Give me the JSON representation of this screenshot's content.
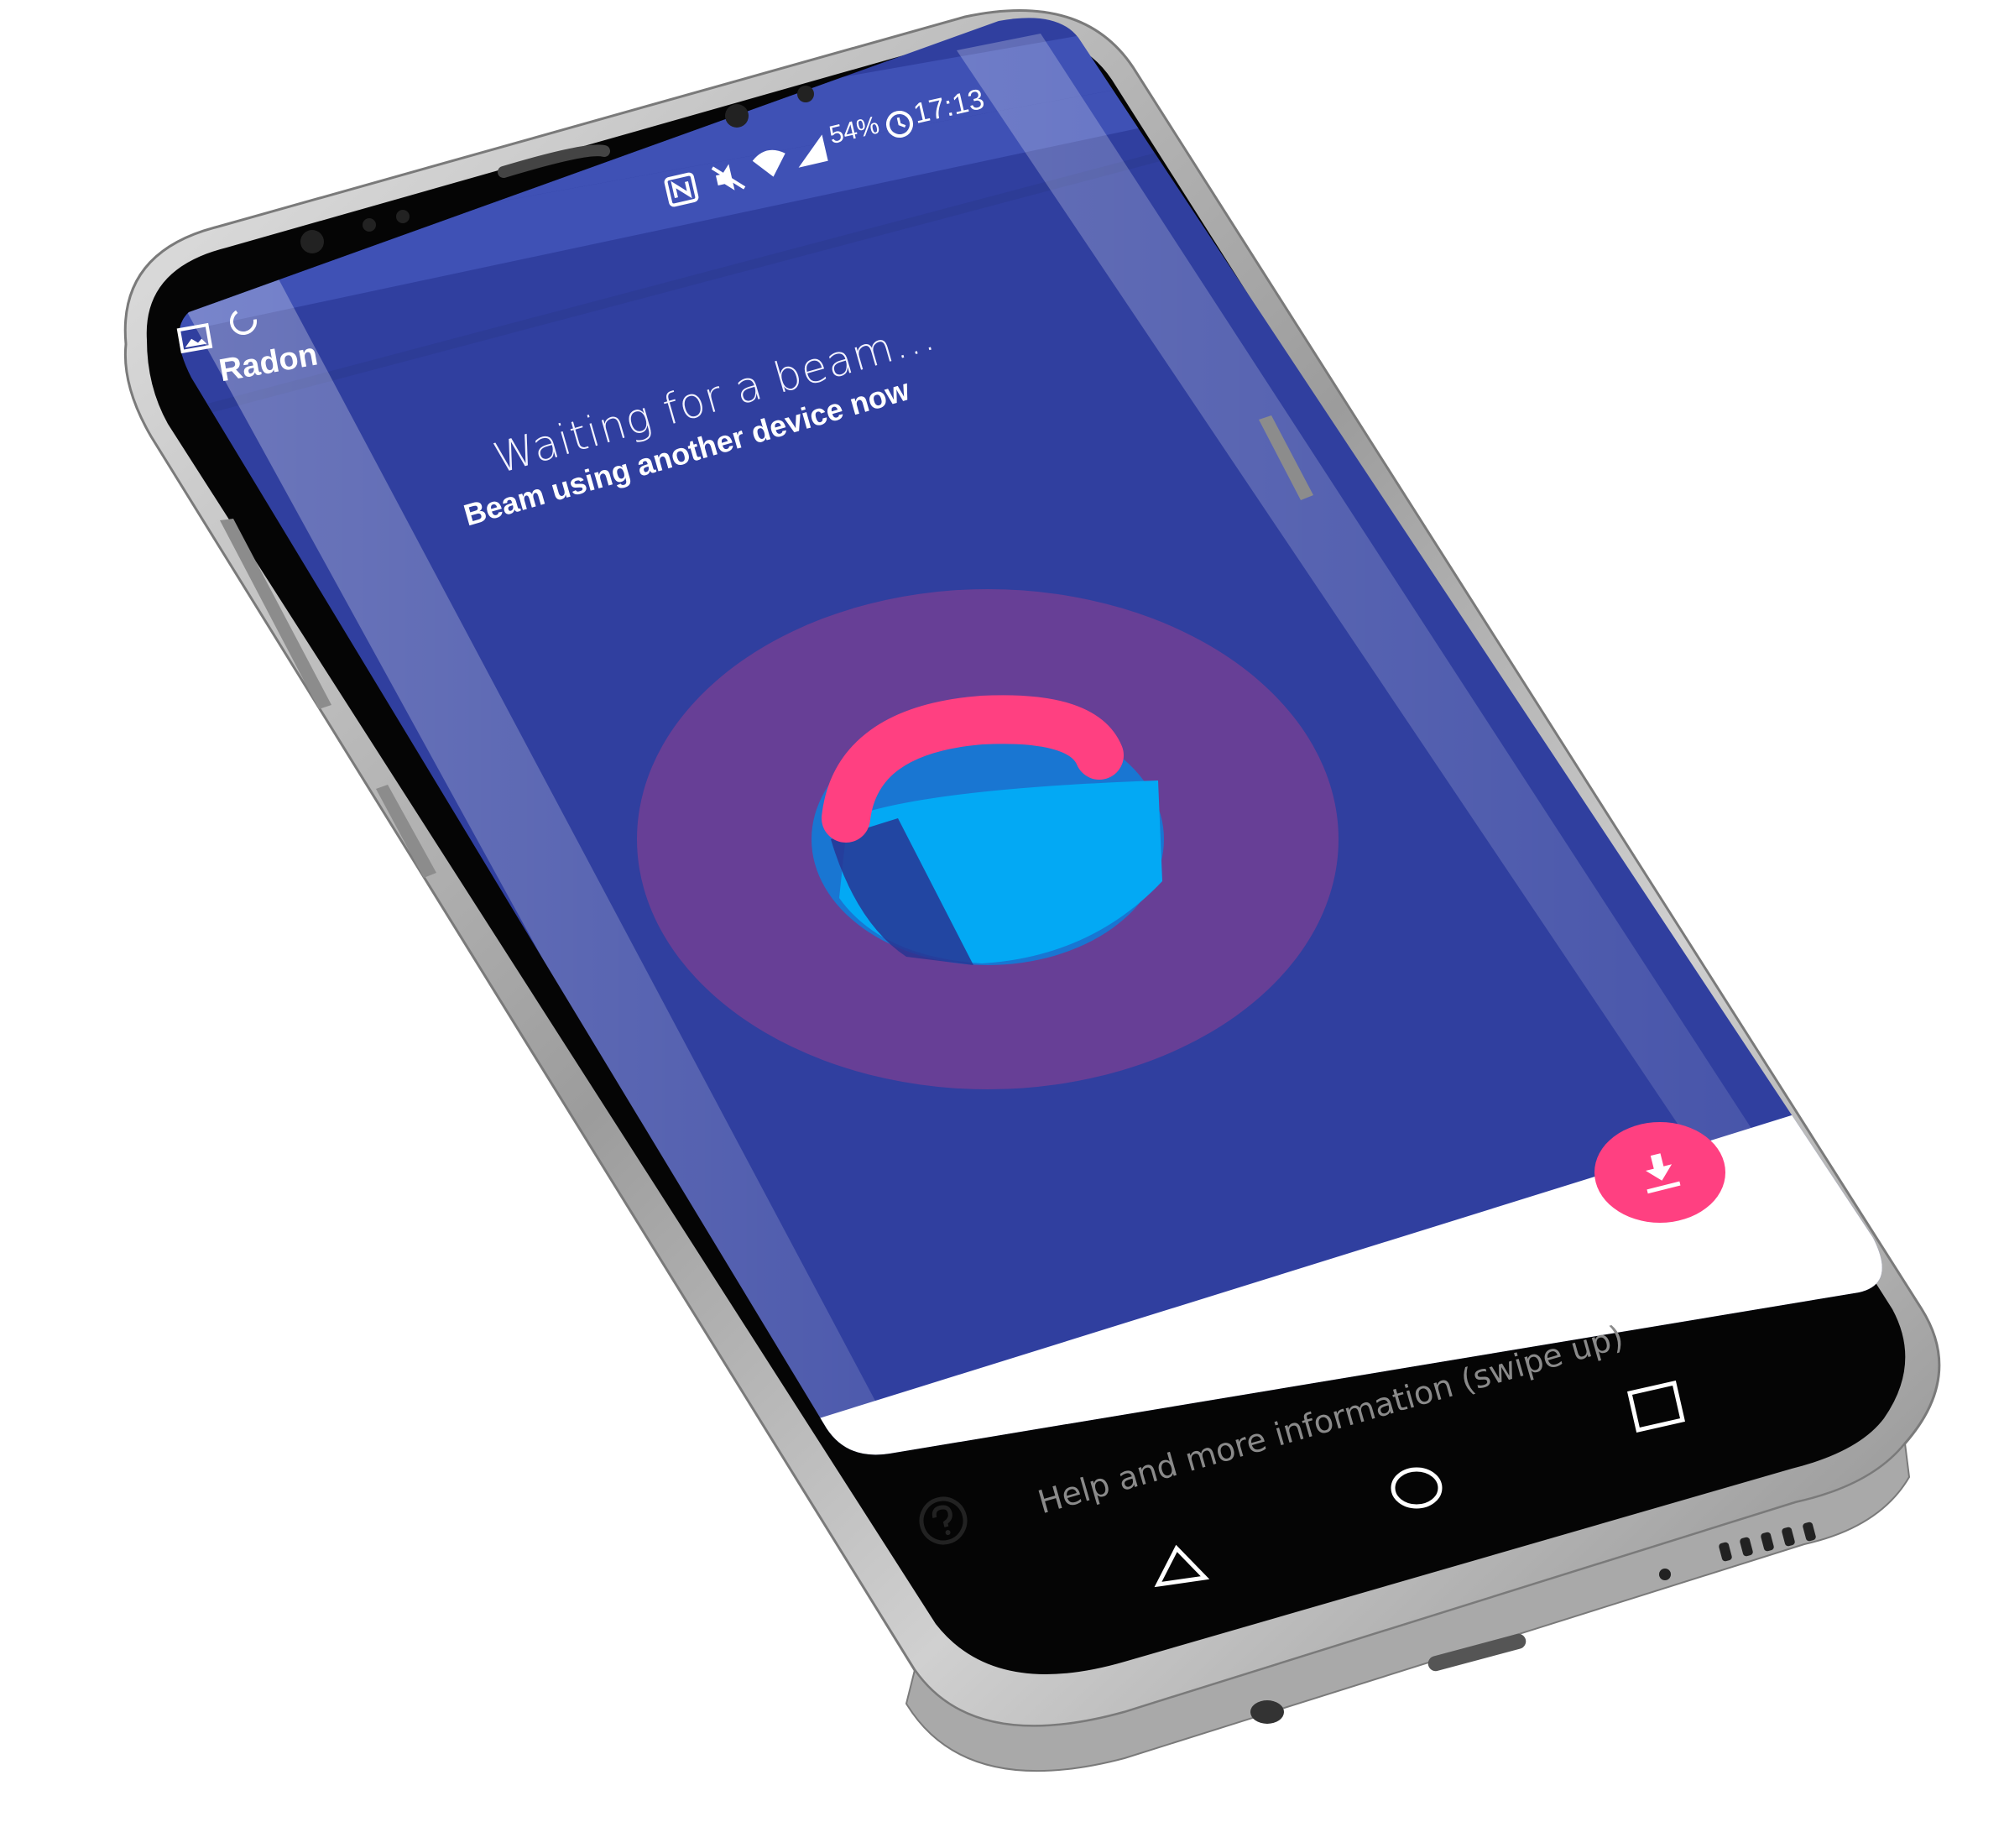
{
  "status_bar": {
    "time": "17:13",
    "battery": "54%",
    "icons": [
      "nfc-icon",
      "mute-icon",
      "wifi-icon",
      "signal-icon",
      "alarm-icon"
    ]
  },
  "notifications": {
    "icons": [
      "image-icon",
      "sync-icon"
    ]
  },
  "app_bar": {
    "title": "Radon"
  },
  "main": {
    "headline": "Waiting for a beam...",
    "subline": "Beam using another device now"
  },
  "fab": {
    "icon": "download-icon",
    "color": "#ff4081"
  },
  "bottom_sheet": {
    "help_text": "Help and more information (swipe up)",
    "help_icon": "help-circle-icon"
  },
  "nav_bar": {
    "buttons": [
      "back-icon",
      "home-icon",
      "recents-icon"
    ]
  },
  "colors": {
    "primary": "#303f9f",
    "primary_light": "#3f51b5",
    "accent": "#ff4081",
    "ring": "#6a3f96",
    "logo_blue": "#1976d2",
    "logo_cyan": "#03a9f4"
  }
}
